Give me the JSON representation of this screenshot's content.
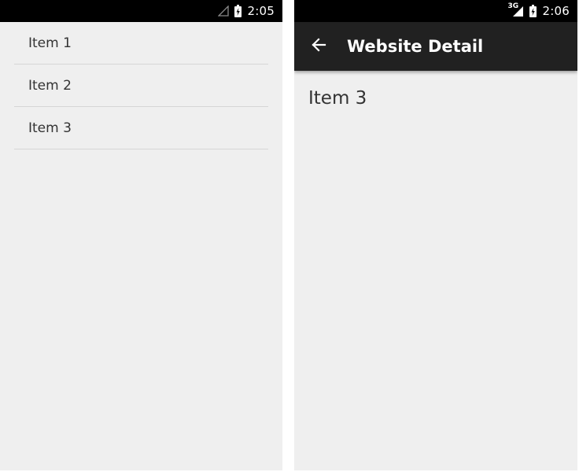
{
  "left_screen": {
    "status_bar": {
      "time": "2:05",
      "icons": [
        "signal-empty-icon",
        "battery-charging-icon"
      ]
    },
    "list": {
      "items": [
        {
          "label": "Item 1"
        },
        {
          "label": "Item 2"
        },
        {
          "label": "Item 3"
        }
      ]
    }
  },
  "right_screen": {
    "status_bar": {
      "time": "2:06",
      "network_label": "3G",
      "icons": [
        "signal-3g-icon",
        "battery-charging-icon"
      ]
    },
    "app_bar": {
      "title": "Website Detail",
      "back_icon": "arrow-back-icon"
    },
    "detail": {
      "text": "Item 3"
    }
  },
  "colors": {
    "status_bar": "#000000",
    "app_bar": "#212121",
    "background": "#efefef",
    "divider": "#d5d5d5",
    "text": "#333333"
  }
}
